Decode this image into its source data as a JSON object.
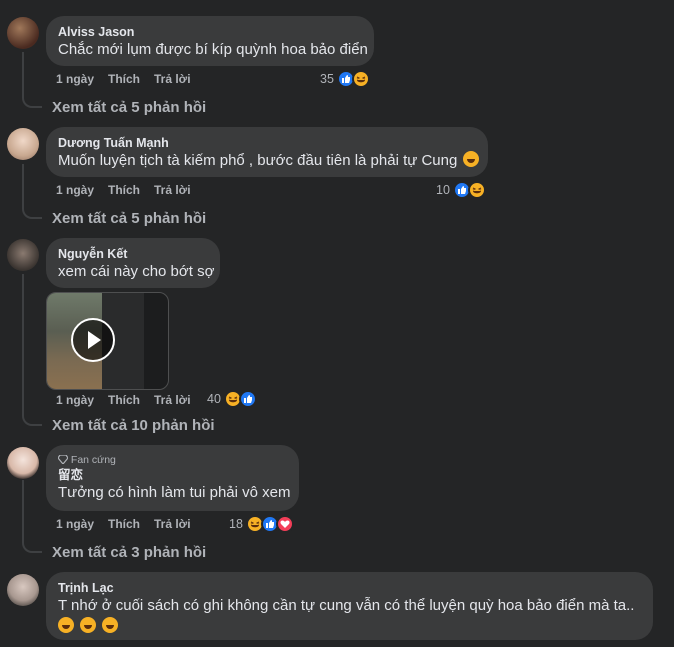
{
  "comments": [
    {
      "name": "Alviss Jason",
      "text": "Chắc mới lụm được bí kíp quỳnh hoa bảo điển",
      "time": "1 ngày",
      "like": "Thích",
      "reply": "Trả lời",
      "reaction_count": "35",
      "reactions": [
        "like-icon",
        "haha-icon"
      ],
      "view_replies": "Xem tất cả 5 phản hồi"
    },
    {
      "name": "Dương Tuấn Mạnh",
      "text": "Muốn luyện tịch tà kiếm phổ , bước đầu tiên là phải tự Cung",
      "time": "1 ngày",
      "like": "Thích",
      "reply": "Trả lời",
      "reaction_count": "10",
      "reactions": [
        "like-icon",
        "haha-icon"
      ],
      "view_replies": "Xem tất cả 5 phản hồi"
    },
    {
      "name": "Nguyễn Kết",
      "text": "xem cái này cho bớt sợ",
      "time": "1 ngày",
      "like": "Thích",
      "reply": "Trả lời",
      "reaction_count": "40",
      "reactions": [
        "haha-icon",
        "like-icon"
      ],
      "view_replies": "Xem tất cả 10 phản hồi"
    },
    {
      "badge": "Fan cứng",
      "name": "留恋",
      "text": "Tưởng có hình làm tui phải vô xem",
      "time": "1 ngày",
      "like": "Thích",
      "reply": "Trả lời",
      "reaction_count": "18",
      "reactions": [
        "haha-icon",
        "like-icon",
        "love-icon"
      ],
      "view_replies": "Xem tất cả 3 phản hồi"
    },
    {
      "name": "Trịnh Lạc",
      "text": "T nhớ ở cuối sách có ghi không cần tự cung vẫn có thể luyện quỳ hoa bảo điển mà ta.."
    }
  ],
  "colors": {
    "background": "#242526",
    "bubble": "#3a3b3c",
    "like": "#2078f4",
    "haha": "#f7b125",
    "love": "#f33e58"
  }
}
